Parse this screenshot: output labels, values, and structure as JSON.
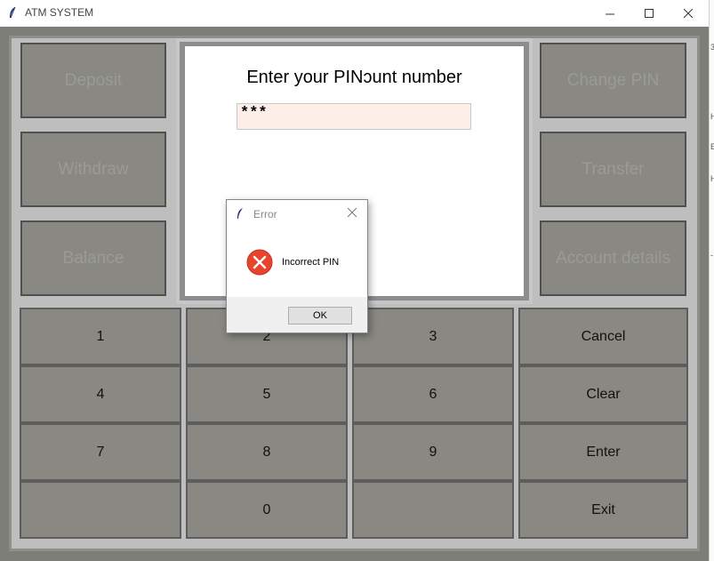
{
  "window": {
    "title": "ATM SYSTEM",
    "app_icon": "feather-icon",
    "controls": [
      "minimize-icon",
      "maximize-icon",
      "close-icon"
    ]
  },
  "side_panel": {
    "buttons_left": [
      "Deposit",
      "Withdraw",
      "Balance"
    ],
    "buttons_right": [
      "Change PIN",
      "Transfer",
      "Account details"
    ]
  },
  "screen": {
    "prompt": "Enter your PINɔunt number",
    "pin_value": "***"
  },
  "keypad": {
    "rows": [
      [
        "1",
        "2",
        "3",
        "Cancel"
      ],
      [
        "4",
        "5",
        "6",
        "Clear"
      ],
      [
        "7",
        "8",
        "9",
        "Enter"
      ],
      [
        "",
        "0",
        "",
        "Exit"
      ]
    ]
  },
  "dialog": {
    "title": "Error",
    "message": "Incorrect PIN",
    "ok_label": "OK",
    "icon": "error-icon"
  },
  "background_window": {
    "edge_glyphs": [
      "3",
      "H",
      "E",
      "H",
      "-"
    ]
  },
  "colors": {
    "frame": "#7e7e78",
    "button": "#898883",
    "disabled_text": "#9b9b96",
    "input_bg": "#fdeee8",
    "error_red": "#e8432d"
  }
}
